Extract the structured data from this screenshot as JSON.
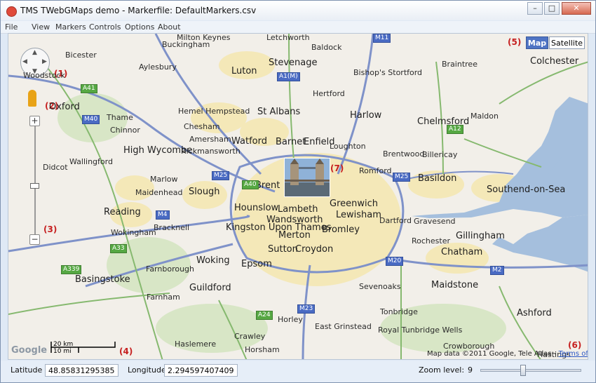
{
  "window": {
    "title": "TMS TWebGMaps demo - Markerfile: DefaultMarkers.csv"
  },
  "menu": [
    "File",
    "View",
    "Markers",
    "Controls",
    "Options",
    "About"
  ],
  "map": {
    "type_buttons": {
      "map": "Map",
      "satellite": "Satellite",
      "active": "map"
    },
    "callouts": [
      "(1)",
      "(2)",
      "(3)",
      "(4)",
      "(5)",
      "(6)",
      "(7)"
    ],
    "scale": {
      "km": "20 km",
      "mi": "10 mi"
    },
    "logo": "Google",
    "attribution": {
      "text": "Map data ©2011 Google, Tele Atlas - ",
      "link": "Terms of Use"
    },
    "places": [
      "Bicester",
      "Buckingham",
      "Milton Keynes",
      "Luton",
      "Stevenage",
      "Letchworth",
      "Baldock",
      "Woodstock",
      "Aylesbury",
      "Hemel Hempstead",
      "St Albans",
      "Hertford",
      "Harlow",
      "Bishop's Stortford",
      "Oxford",
      "Thame",
      "Chinnor",
      "Chesham",
      "Watford",
      "Barnet",
      "Enfield",
      "Chelmsford",
      "Braintree",
      "Colchester",
      "High Wycombe",
      "Amersham",
      "Rickmansworth",
      "Loughton",
      "Brentwood",
      "Billericay",
      "Maldon",
      "Didcot",
      "Wallingford",
      "Marlow",
      "Maidenhead",
      "Slough",
      "Brent",
      "Romford",
      "Basildon",
      "Reading",
      "Wokingham",
      "Bracknell",
      "Hounslow",
      "Lambeth",
      "Greenwich",
      "Lewisham",
      "Southend-on-Sea",
      "Kingston Upon Thames",
      "Wandsworth",
      "Merton",
      "Bromley",
      "Sutton",
      "Croydon",
      "Dartford",
      "Gravesend",
      "Basingstoke",
      "Farnborough",
      "Woking",
      "Guildford",
      "Epsom",
      "Sevenoaks",
      "Maidstone",
      "Rochester",
      "Chatham",
      "Gillingham",
      "Farnham",
      "Horley",
      "Crawley",
      "East Grinstead",
      "Royal Tunbridge Wells",
      "Tonbridge",
      "Ashford",
      "Haslemere",
      "Horsham",
      "Crowborough",
      "Hastings"
    ]
  },
  "status": {
    "lat_label": "Latitude :",
    "lat_value": "48.8583129538527",
    "lng_label": "Longitude:",
    "lng_value": "2.2945974074097",
    "zoom_label": "Zoom level:",
    "zoom_value": "9",
    "zoom_fraction": 0.42
  },
  "colors": {
    "accent": "#4f74c4",
    "callout": "#c62020",
    "land": "#f2efe9",
    "water": "#a5bfdd",
    "urban": "#f4e8b8"
  },
  "icons": [
    "app-icon",
    "minimize-icon",
    "maximize-icon",
    "close-icon",
    "pan-control-icon",
    "pegman-icon",
    "zoom-in-icon",
    "zoom-out-icon",
    "photo-marker-icon"
  ]
}
